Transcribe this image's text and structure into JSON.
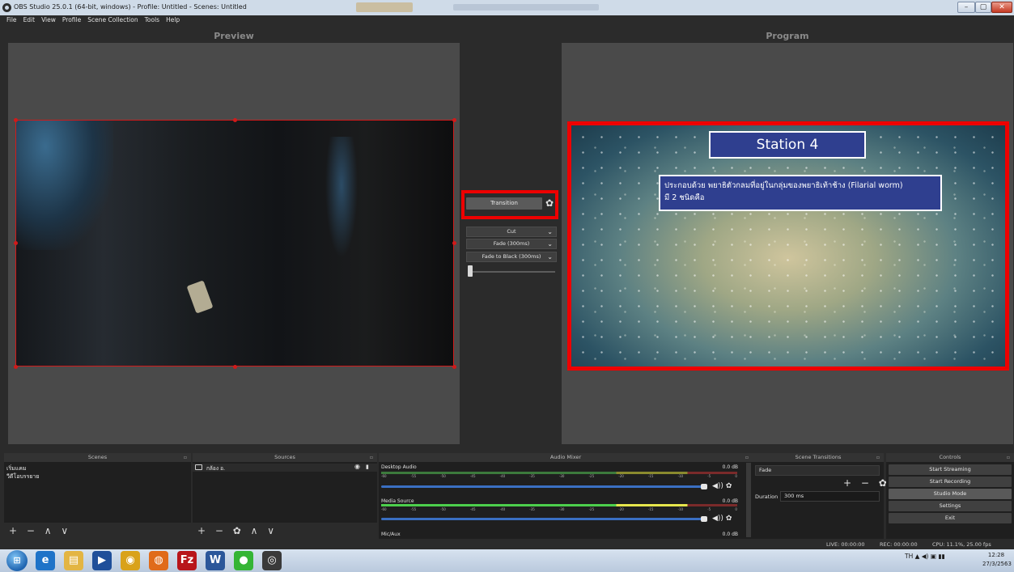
{
  "window": {
    "title": "OBS Studio 25.0.1 (64-bit, windows) - Profile: Untitled - Scenes: Untitled",
    "min_glyph": "–",
    "max_glyph": "▢",
    "close_glyph": "✕"
  },
  "menu": [
    "File",
    "Edit",
    "View",
    "Profile",
    "Scene Collection",
    "Tools",
    "Help"
  ],
  "preview": {
    "label": "Preview"
  },
  "program": {
    "label": "Program",
    "slide_title": "Station 4",
    "slide_text_line1": "ประกอบด้วย พยาธิตัวกลมที่อยู่ในกลุ่มของพยาธิเท้าช้าง (Filarial worm)",
    "slide_text_line2": "มี 2 ชนิดคือ"
  },
  "transition": {
    "button_label": "Transition",
    "gear_glyph": "✿",
    "options": [
      "Cut",
      "Fade (300ms)",
      "Fade to Black (300ms)"
    ],
    "chevron": "⌄",
    "tbar_position": 0
  },
  "docks": {
    "scenes": {
      "title": "Scenes",
      "items": [
        "เริ่มแคม",
        "วีดีโอบรรยาย"
      ]
    },
    "sources": {
      "title": "Sources",
      "items": [
        {
          "name": "กล้อง อ."
        }
      ]
    },
    "audio": {
      "title": "Audio Mixer",
      "channels": [
        {
          "name": "Desktop Audio",
          "db": "0.0 dB",
          "level": 0.0,
          "volume": 1.0
        },
        {
          "name": "Media Source",
          "db": "0.0 dB",
          "level": 1.0,
          "volume": 1.0
        },
        {
          "name": "Mic/Aux",
          "db": "0.0 dB",
          "level": 0.0,
          "volume": 1.0
        }
      ],
      "tick_labels": [
        "-60",
        "-55",
        "-50",
        "-45",
        "-40",
        "-35",
        "-30",
        "-25",
        "-20",
        "-15",
        "-10",
        "-5",
        "0"
      ],
      "speaker_glyph": "◀))",
      "gear_glyph": "✿"
    },
    "transitions": {
      "title": "Scene Transitions",
      "selected": "Fade",
      "duration_label": "Duration",
      "duration_value": "300 ms",
      "icons": "+ − ✿"
    },
    "controls": {
      "title": "Controls",
      "buttons": [
        "Start Streaming",
        "Start Recording",
        "Studio Mode",
        "Settings",
        "Exit"
      ],
      "active": "Studio Mode"
    },
    "float_glyph": "▫",
    "footer_icons_scenes": "+ − ∧ ∨",
    "footer_icons_sources": "+ − ✿ ∧ ∨"
  },
  "status": {
    "live": "LIVE: 00:00:00",
    "rec": "REC: 00:00:00",
    "cpu": "CPU: 11.1%, 25.00 fps"
  },
  "taskbar": {
    "apps": [
      {
        "name": "internet-explorer",
        "glyph": "e",
        "color": "#1e73c8"
      },
      {
        "name": "file-explorer",
        "glyph": "▤",
        "color": "#e3b543"
      },
      {
        "name": "media-player",
        "glyph": "▶",
        "color": "#1f4f9a"
      },
      {
        "name": "chrome",
        "glyph": "◉",
        "color": "#d9a21a"
      },
      {
        "name": "firefox",
        "glyph": "◍",
        "color": "#e06b1a"
      },
      {
        "name": "filezilla",
        "glyph": "Fz",
        "color": "#b8151a"
      },
      {
        "name": "word",
        "glyph": "W",
        "color": "#2b579a"
      },
      {
        "name": "line",
        "glyph": "●",
        "color": "#35b535"
      },
      {
        "name": "obs",
        "glyph": "◎",
        "color": "#3a3a3a"
      }
    ],
    "tray_lang": "TH",
    "clock_time": "12:28",
    "clock_date": "27/3/2563"
  }
}
